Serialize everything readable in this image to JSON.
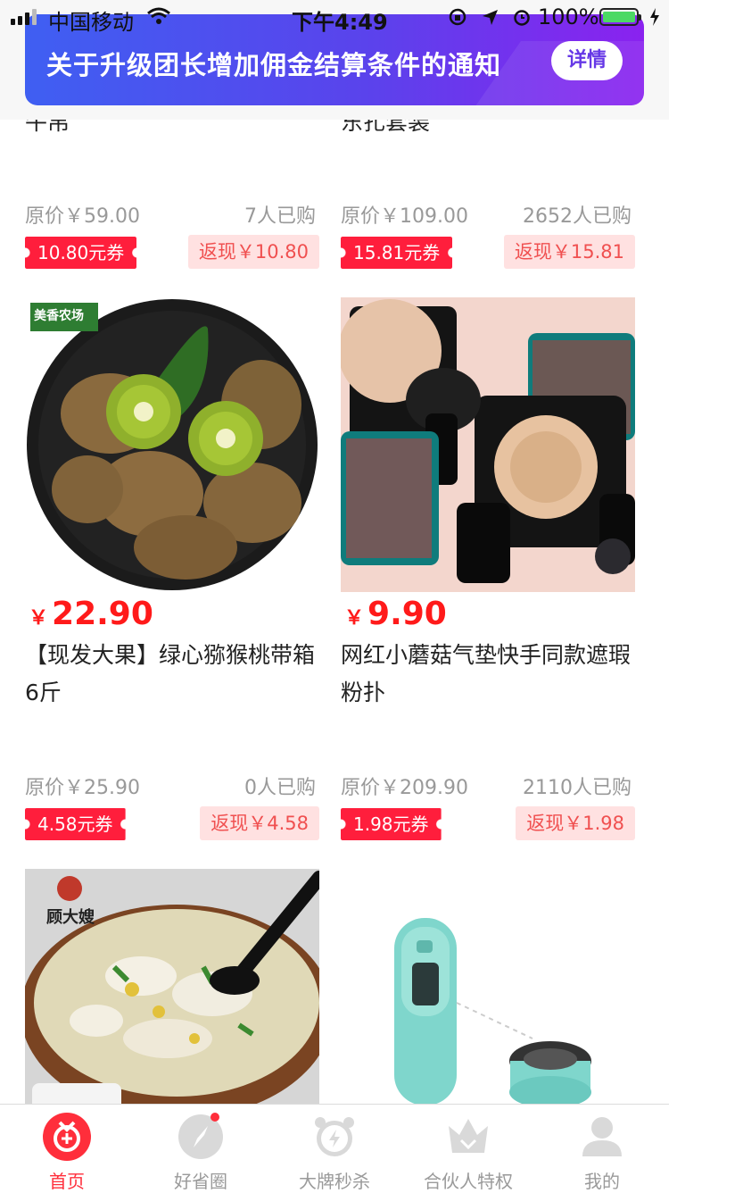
{
  "status_bar": {
    "carrier": "中国移动",
    "time": "下午4:49",
    "battery": "100%"
  },
  "banner": {
    "title": "关于升级团长增加佣金结算条件的通知",
    "button": "详情"
  },
  "products": [
    {
      "title_fragment": "牛帛",
      "original_price": "原价￥59.00",
      "sold": "7人已购",
      "coupon": "10.80元券",
      "cashback": "返现￥10.80"
    },
    {
      "title_fragment": "东扎套装",
      "original_price": "原价￥109.00",
      "sold": "2652人已购",
      "coupon": "15.81元券",
      "cashback": "返现￥15.81"
    },
    {
      "image": "kiwifruit-photo",
      "image_logo": "美香农场",
      "currency": "￥",
      "price": "22.90",
      "title": "【现发大果】绿心猕猴桃带箱6斤",
      "original_price": "原价￥25.90",
      "sold": "0人已购",
      "coupon": "4.58元券",
      "cashback": "返现￥4.58"
    },
    {
      "image": "cushion-compact-photo",
      "currency": "￥",
      "price": "9.90",
      "title": "网红小蘑菇气垫快手同款遮瑕粉扑",
      "original_price": "原价￥209.90",
      "sold": "2110人已购",
      "coupon": "1.98元券",
      "cashback": "返现￥1.98"
    },
    {
      "image": "wonton-soup-photo",
      "image_logo": "顾大嫂"
    },
    {
      "image": "portable-water-bottle-photo"
    }
  ],
  "tabbar": [
    {
      "label": "首页",
      "icon": "home-coin-icon",
      "active": true
    },
    {
      "label": "好省圈",
      "icon": "compass-icon",
      "badge": true
    },
    {
      "label": "大牌秒杀",
      "icon": "alarm-clock-icon"
    },
    {
      "label": "合伙人特权",
      "icon": "crown-icon"
    },
    {
      "label": "我的",
      "icon": "person-icon"
    }
  ],
  "colors": {
    "accent_red": "#ff1e3c",
    "price_red": "#ff1a1a",
    "banner_gradient_start": "#3f5ff2",
    "banner_gradient_end": "#8a22ef",
    "cashback_bg": "#ffe1e1"
  }
}
